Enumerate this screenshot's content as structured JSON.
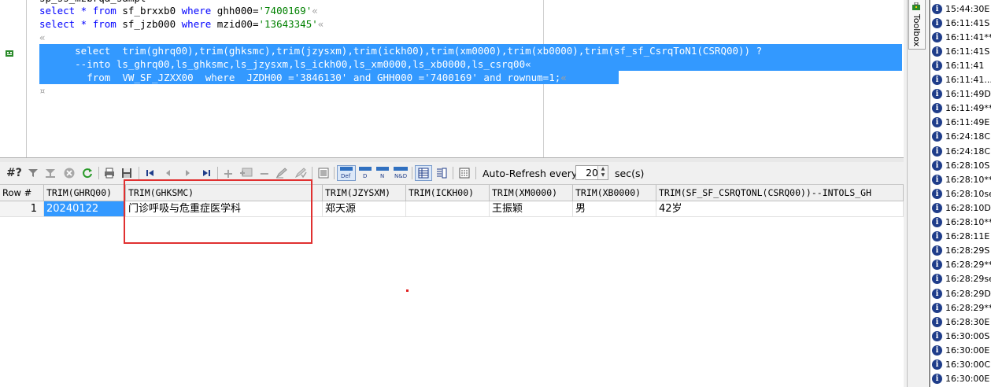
{
  "editor": {
    "partial_top": "sp_ss_mzbrqa_sampl",
    "lines": [
      {
        "kw1": "select",
        "star": " * ",
        "kw2": "from",
        "table": " sf_brxxb0 ",
        "kw3": "where",
        "cond": " ghh000=",
        "val": "'7400169'",
        "pm": "«"
      },
      {
        "kw1": "select",
        "star": " * ",
        "kw2": "from",
        "table": " sf_jzb000 ",
        "kw3": "where",
        "cond": " mzid00=",
        "val": "'13643345'",
        "pm": "«"
      }
    ],
    "blank_pm": "«",
    "selected": [
      "      select  trim(ghrq00),trim(ghksmc),trim(jzysxm),trim(ickh00),trim(xm0000),trim(xb0000),trim(sf_sf_CsrqToN1(CSRQ00)) ?",
      "      --into ls_ghrq00,ls_ghksmc,ls_jzysxm,ls_ickh00,ls_xm0000,ls_xb0000,ls_csrq00«",
      "        from  VW_SF_JZXX00  where  JZDH00 ='3846130' and GHH000 ='7400169' and rownum=1;"
    ],
    "selected_tail_pm": "«",
    "end_pm": "¤"
  },
  "toolbar": {
    "hash_label": "#?",
    "auto_refresh_label": "Auto-Refresh every",
    "refresh_value": "20",
    "sec_label": "sec(s)"
  },
  "grid": {
    "headers": [
      "Row #",
      "TRIM(GHRQ00)",
      "TRIM(GHKSMC)",
      "TRIM(JZYSXM)",
      "TRIM(ICKH00)",
      "TRIM(XM0000)",
      "TRIM(XB0000)",
      "TRIM(SF_SF_CSRQTONL(CSRQ00))--INTOLS_GH"
    ],
    "rows": [
      [
        "1",
        "20240122",
        "门诊呼吸与危重症医学科",
        "郑天源",
        "",
        "王振颖",
        "男",
        "42岁"
      ]
    ]
  },
  "toolbox": {
    "label": "Toolbox"
  },
  "log": [
    {
      "time": "15:44:30",
      "text": "E"
    },
    {
      "time": "16:11:41",
      "text": "S"
    },
    {
      "time": "16:11:41",
      "text": "**"
    },
    {
      "time": "16:11:41",
      "text": "S"
    },
    {
      "time": "16:11:41",
      "text": ""
    },
    {
      "time": "16:11:41",
      "text": "..."
    },
    {
      "time": "16:11:49",
      "text": "D"
    },
    {
      "time": "16:11:49",
      "text": "**"
    },
    {
      "time": "16:11:49",
      "text": "E"
    },
    {
      "time": "16:24:18",
      "text": "C"
    },
    {
      "time": "16:24:18",
      "text": "C"
    },
    {
      "time": "16:28:10",
      "text": "S"
    },
    {
      "time": "16:28:10",
      "text": "**"
    },
    {
      "time": "16:28:10",
      "text": "se"
    },
    {
      "time": "16:28:10",
      "text": "D"
    },
    {
      "time": "16:28:10",
      "text": "**"
    },
    {
      "time": "16:28:11",
      "text": "E"
    },
    {
      "time": "16:28:29",
      "text": "S"
    },
    {
      "time": "16:28:29",
      "text": "**"
    },
    {
      "time": "16:28:29",
      "text": "se"
    },
    {
      "time": "16:28:29",
      "text": "D"
    },
    {
      "time": "16:28:29",
      "text": "**"
    },
    {
      "time": "16:28:30",
      "text": "E"
    },
    {
      "time": "16:30:00",
      "text": "S"
    },
    {
      "time": "16:30:00",
      "text": "E"
    },
    {
      "time": "16:30:00",
      "text": "C"
    },
    {
      "time": "16:30:00",
      "text": "E"
    }
  ]
}
